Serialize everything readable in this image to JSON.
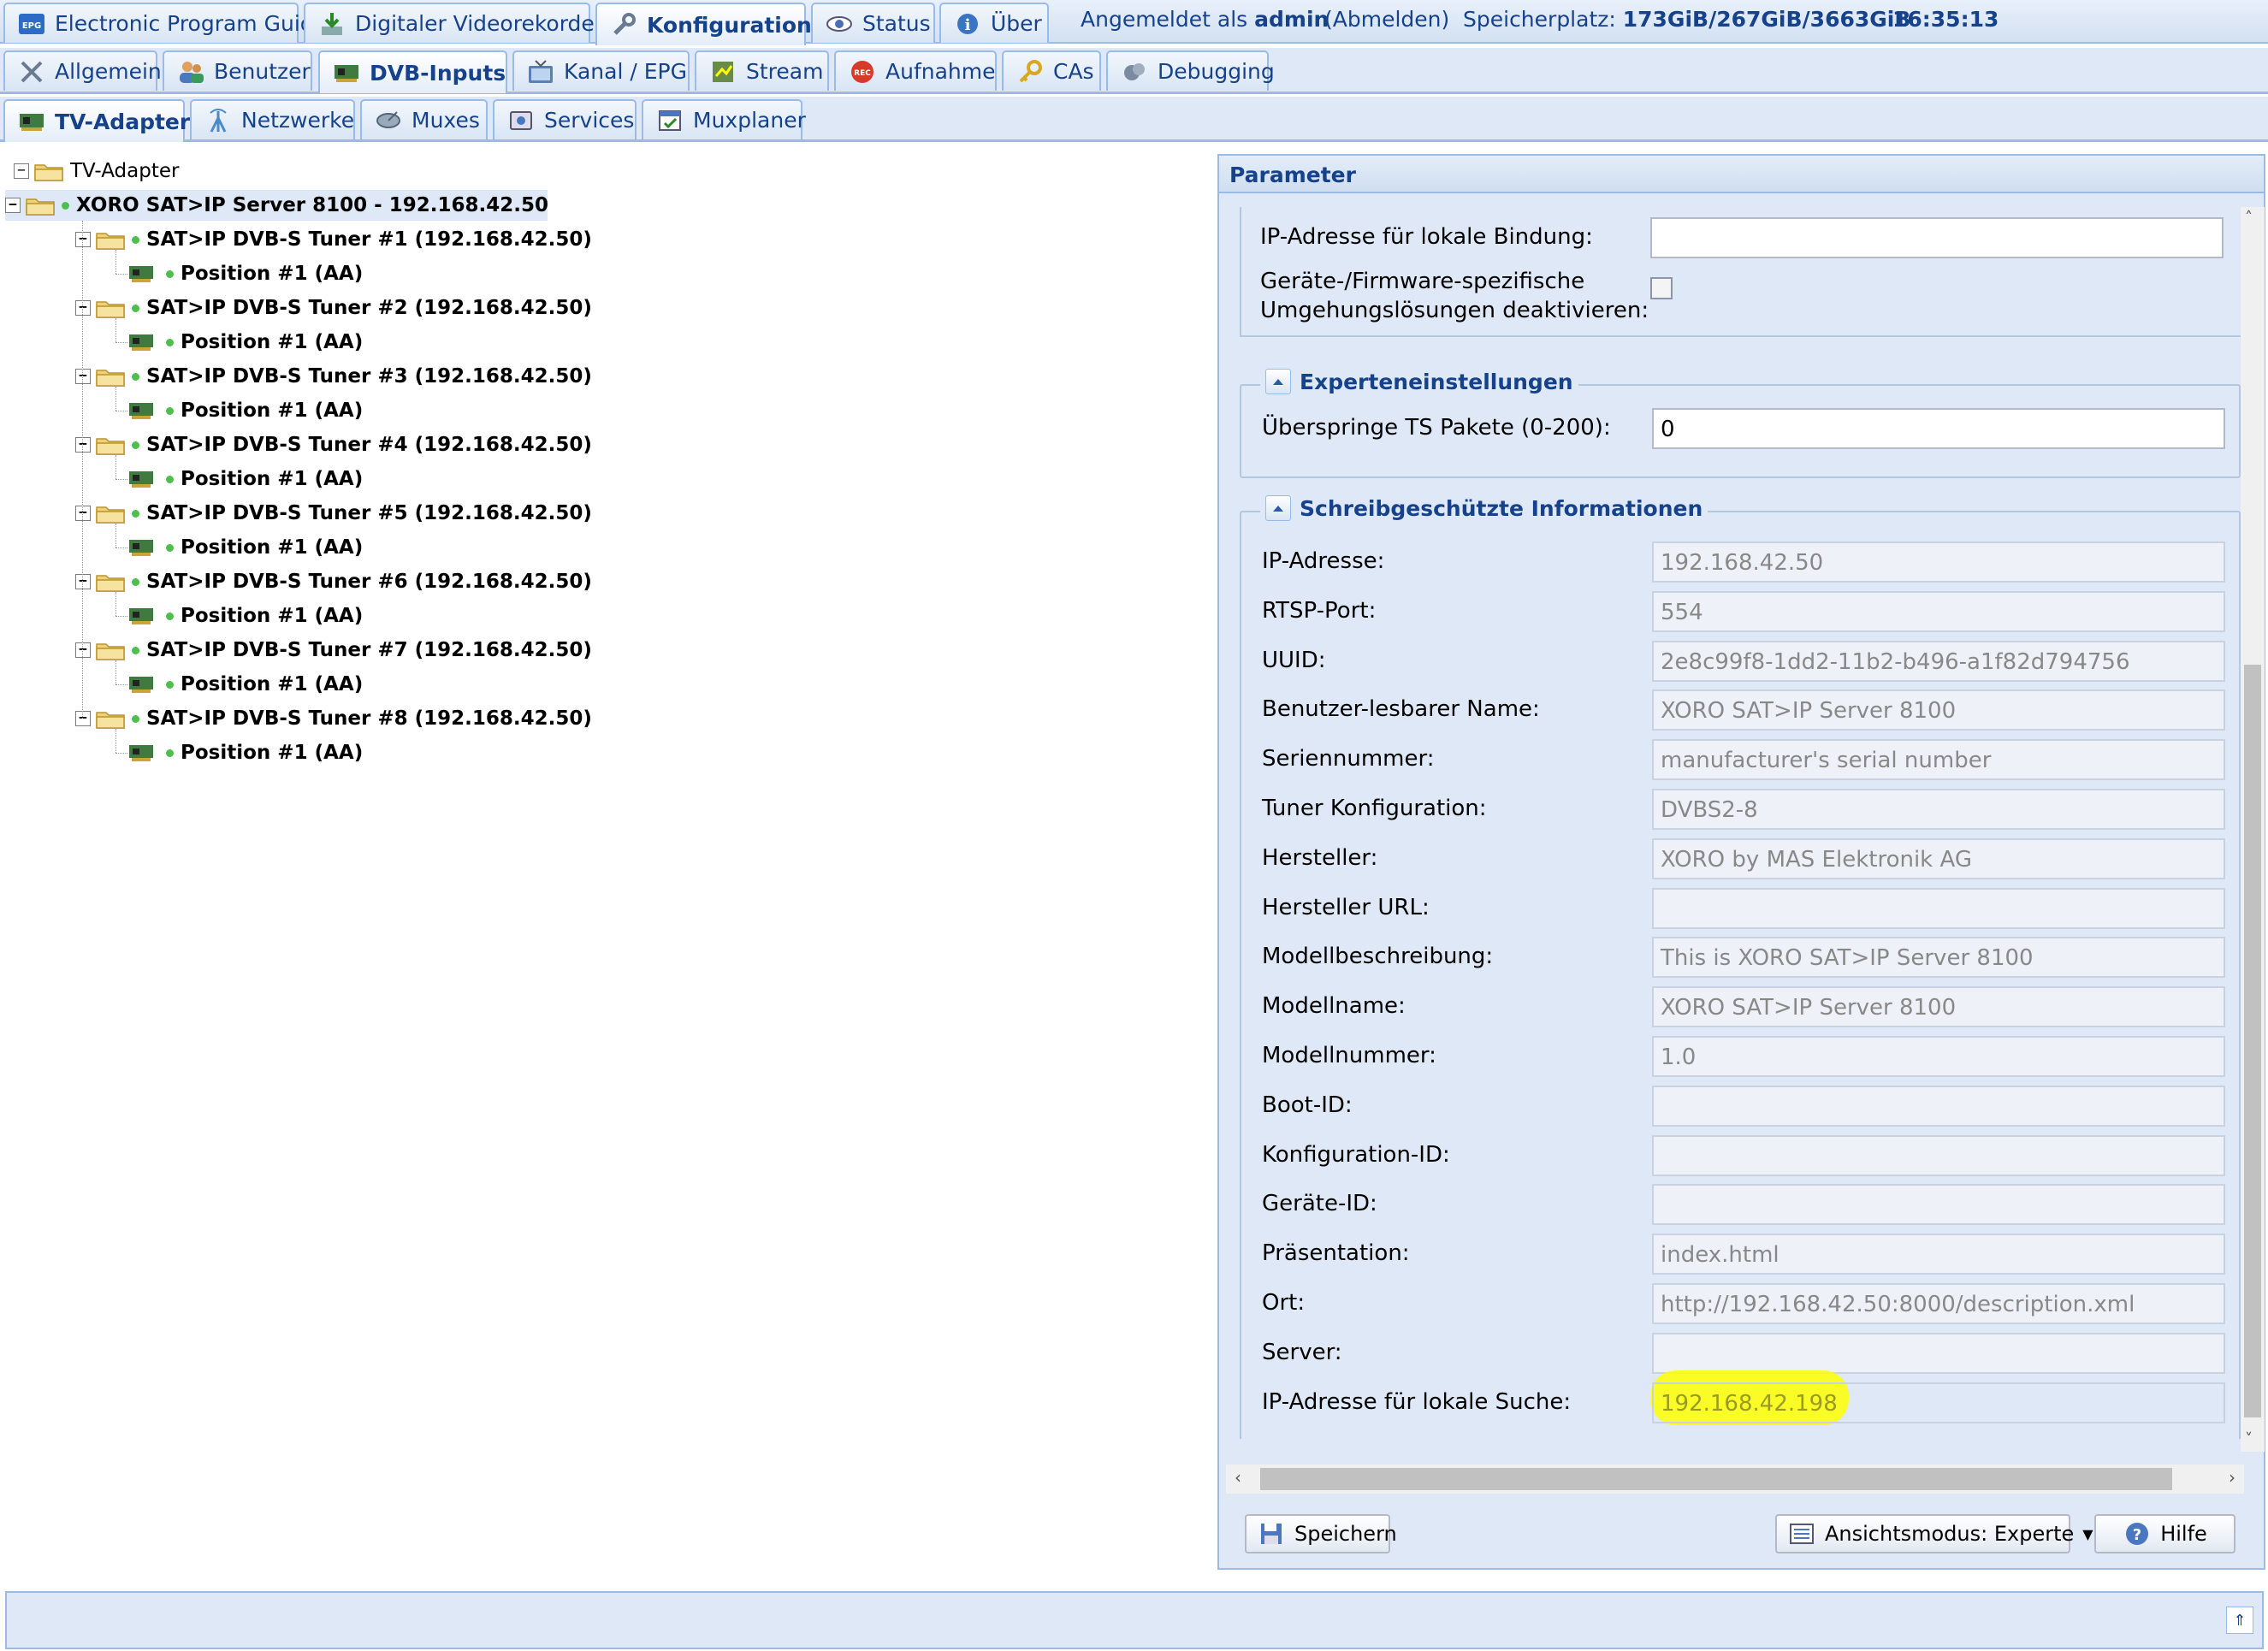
{
  "top_tabs": [
    {
      "label": "Electronic Program Guide",
      "icon": "epg-icon"
    },
    {
      "label": "Digitaler Videorekorder",
      "icon": "download-icon"
    },
    {
      "label": "Konfiguration",
      "icon": "wrench-icon",
      "active": true
    },
    {
      "label": "Status",
      "icon": "eye-icon"
    },
    {
      "label": "Über",
      "icon": "info-icon"
    }
  ],
  "header": {
    "logged_in_prefix": "Angemeldet als",
    "user": "admin",
    "logout": "(Abmelden)",
    "storage_label": "Speicherplatz:",
    "storage_value": "173GiB/267GiB/3663GiB",
    "time": "16:35:13"
  },
  "config_tabs": [
    {
      "label": "Allgemein",
      "icon": "tools-icon"
    },
    {
      "label": "Benutzer",
      "icon": "users-icon"
    },
    {
      "label": "DVB-Inputs",
      "icon": "card-icon",
      "active": true
    },
    {
      "label": "Kanal / EPG",
      "icon": "tv-icon"
    },
    {
      "label": "Stream",
      "icon": "stream-icon"
    },
    {
      "label": "Aufnahme",
      "icon": "rec-icon"
    },
    {
      "label": "CAs",
      "icon": "key-icon"
    },
    {
      "label": "Debugging",
      "icon": "bug-icon"
    }
  ],
  "dvb_tabs": [
    {
      "label": "TV-Adapter",
      "icon": "card-icon",
      "active": true
    },
    {
      "label": "Netzwerke",
      "icon": "antenna-icon"
    },
    {
      "label": "Muxes",
      "icon": "satellite-icon"
    },
    {
      "label": "Services",
      "icon": "services-icon"
    },
    {
      "label": "Muxplaner",
      "icon": "planner-icon"
    }
  ],
  "tree": {
    "root": "TV-Adapter",
    "server": "XORO SAT>IP Server 8100 - 192.168.42.50",
    "tuners": [
      {
        "label": "SAT>IP DVB-S Tuner #1 (192.168.42.50)",
        "position": "Position #1 (AA)"
      },
      {
        "label": "SAT>IP DVB-S Tuner #2 (192.168.42.50)",
        "position": "Position #1 (AA)"
      },
      {
        "label": "SAT>IP DVB-S Tuner #3 (192.168.42.50)",
        "position": "Position #1 (AA)"
      },
      {
        "label": "SAT>IP DVB-S Tuner #4 (192.168.42.50)",
        "position": "Position #1 (AA)"
      },
      {
        "label": "SAT>IP DVB-S Tuner #5 (192.168.42.50)",
        "position": "Position #1 (AA)"
      },
      {
        "label": "SAT>IP DVB-S Tuner #6 (192.168.42.50)",
        "position": "Position #1 (AA)"
      },
      {
        "label": "SAT>IP DVB-S Tuner #7 (192.168.42.50)",
        "position": "Position #1 (AA)"
      },
      {
        "label": "SAT>IP DVB-S Tuner #8 (192.168.42.50)",
        "position": "Position #1 (AA)"
      }
    ]
  },
  "panel": {
    "title": "Parameter",
    "top_fields": [
      {
        "label": "IP-Adresse für lokale Bindung:",
        "value": ""
      }
    ],
    "workaround_label_1": "Geräte-/Firmware-spezifische",
    "workaround_label_2": "Umgehungslösungen deaktivieren:",
    "expert_title": "Experteneinstellungen",
    "expert_fields": [
      {
        "label": "Überspringe TS Pakete (0-200):",
        "value": "0"
      }
    ],
    "readonly_title": "Schreibgeschützte Informationen",
    "readonly_fields": [
      {
        "label": "IP-Adresse:",
        "value": "192.168.42.50"
      },
      {
        "label": "RTSP-Port:",
        "value": "554"
      },
      {
        "label": "UUID:",
        "value": "2e8c99f8-1dd2-11b2-b496-a1f82d794756"
      },
      {
        "label": "Benutzer-lesbarer Name:",
        "value": "XORO SAT>IP Server 8100"
      },
      {
        "label": "Seriennummer:",
        "value": "manufacturer's serial number"
      },
      {
        "label": "Tuner Konfiguration:",
        "value": "DVBS2-8"
      },
      {
        "label": "Hersteller:",
        "value": "XORO by MAS Elektronik AG"
      },
      {
        "label": "Hersteller URL:",
        "value": ""
      },
      {
        "label": "Modellbeschreibung:",
        "value": "This is XORO SAT>IP Server 8100"
      },
      {
        "label": "Modellname:",
        "value": "XORO SAT>IP Server 8100"
      },
      {
        "label": "Modellnummer:",
        "value": "1.0"
      },
      {
        "label": "Boot-ID:",
        "value": ""
      },
      {
        "label": "Konfiguration-ID:",
        "value": ""
      },
      {
        "label": "Geräte-ID:",
        "value": ""
      },
      {
        "label": "Präsentation:",
        "value": "index.html"
      },
      {
        "label": "Ort:",
        "value": "http://192.168.42.50:8000/description.xml"
      },
      {
        "label": "Server:",
        "value": ""
      },
      {
        "label": "IP-Adresse für lokale Suche:",
        "value": "192.168.42.198"
      }
    ],
    "buttons": {
      "save": "Speichern",
      "view_mode": "Ansichtsmodus: Experte",
      "help": "Hilfe"
    }
  },
  "colors": {
    "accent": "#15428b",
    "border": "#99bbe8",
    "panel_bg": "#dfe8f6",
    "highlight": "#ffff00"
  }
}
